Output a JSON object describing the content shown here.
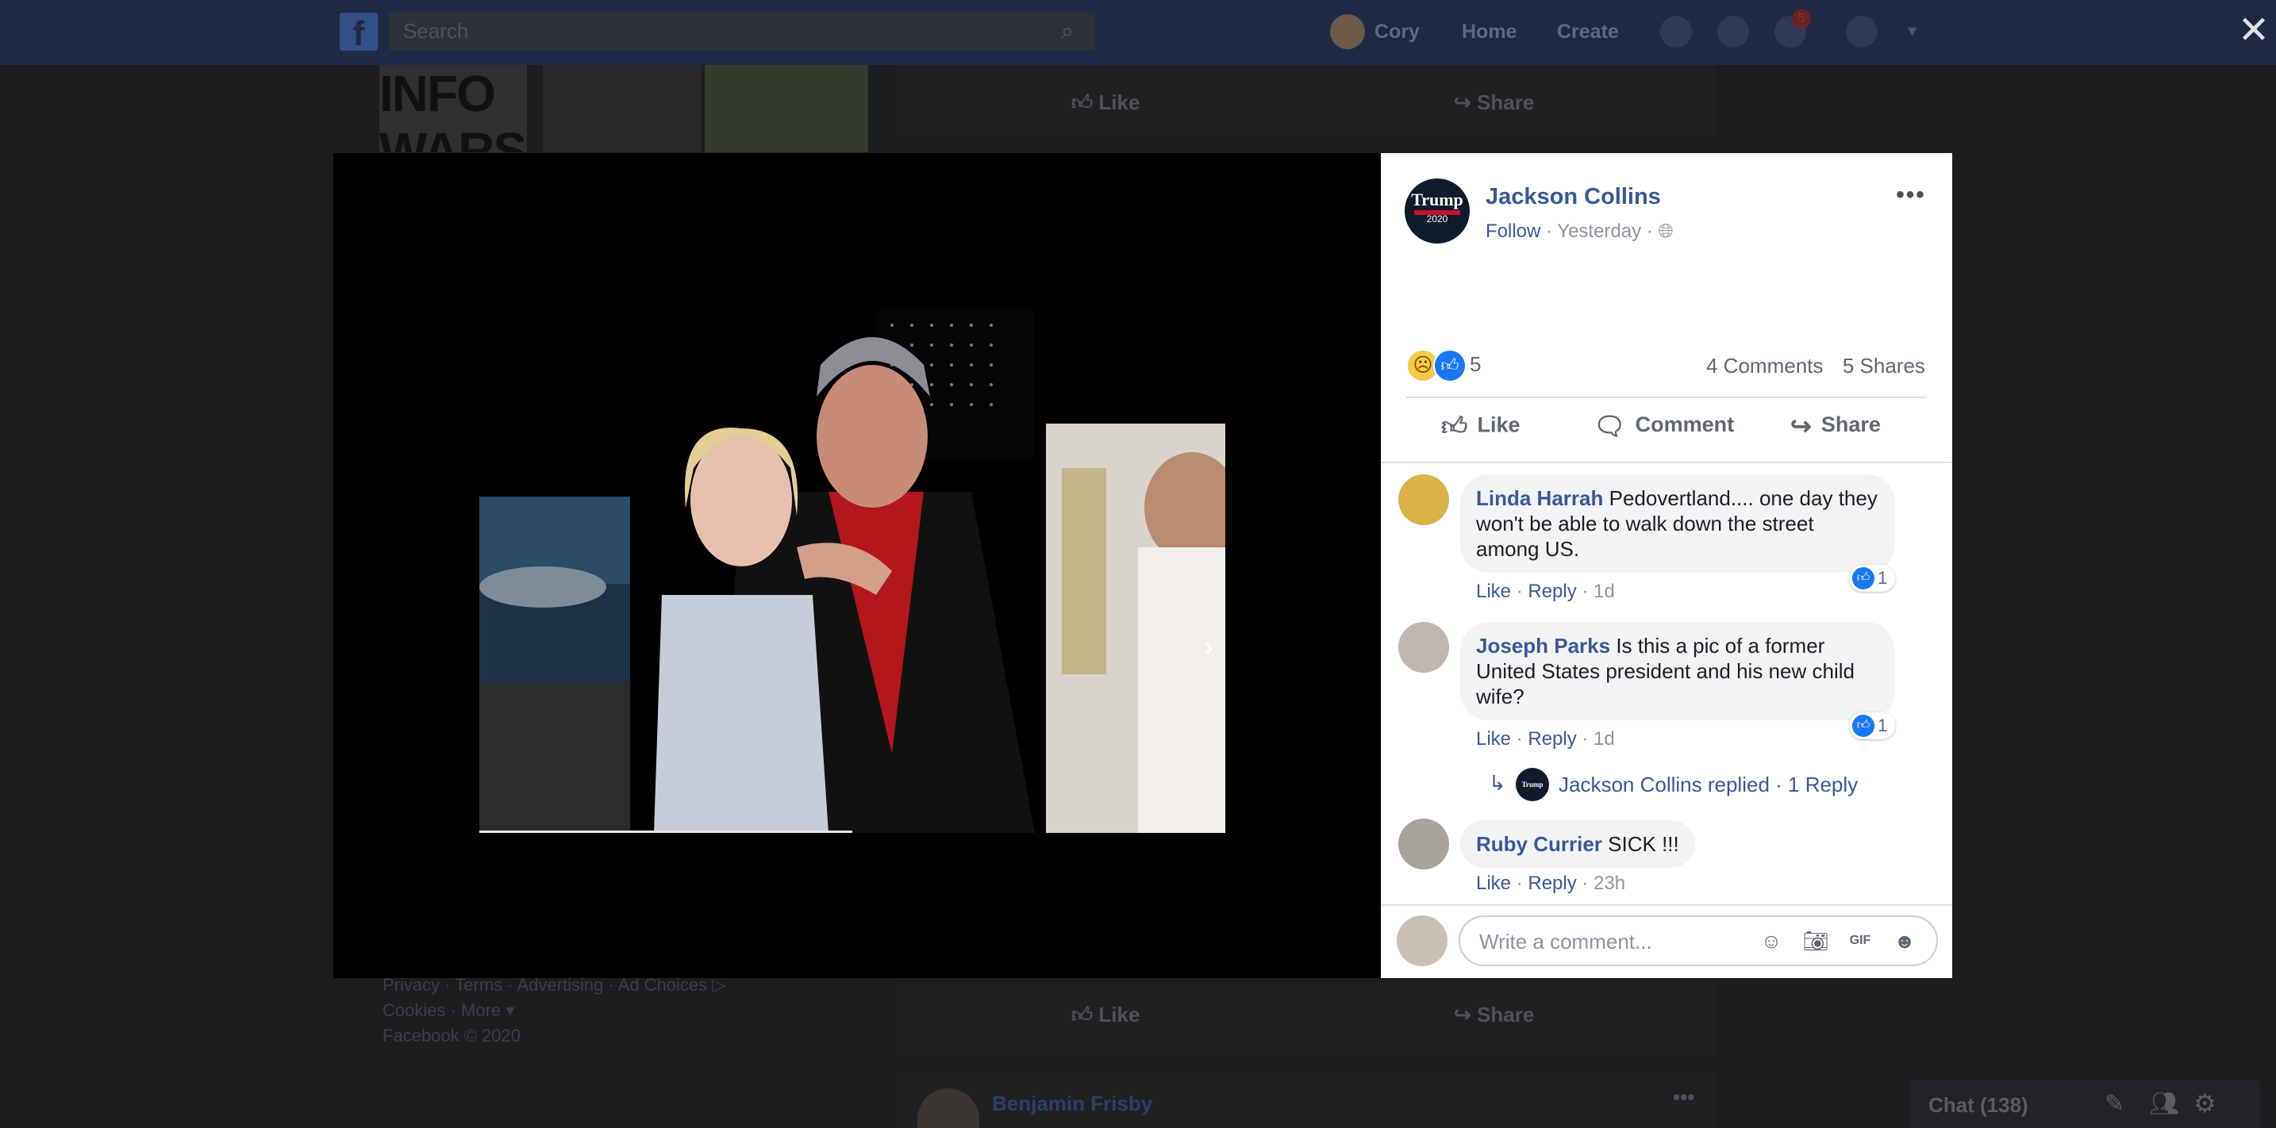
{
  "topbar": {
    "search_placeholder": "Search",
    "user_name": "Cory",
    "home_label": "Home",
    "create_label": "Create",
    "notification_count": "5"
  },
  "background": {
    "brand_text": "INFO WARS",
    "like_label": "Like",
    "share_label": "Share",
    "footer_line1": "Privacy · Terms · Advertising · Ad Choices ▷",
    "footer_line2": "Cookies · More ▾",
    "footer_copyright": "Facebook © 2020",
    "next_post_author": "Benjamin Frisby",
    "chat_label": "Chat (138)"
  },
  "post": {
    "author": "Jackson Collins",
    "follow_label": "Follow",
    "time": "Yesterday",
    "avatar_text": "Trump",
    "avatar_sub": "2020",
    "reaction_count": "5",
    "comments_count": "4 Comments",
    "shares_count": "5 Shares",
    "actions": {
      "like": "Like",
      "comment": "Comment",
      "share": "Share"
    }
  },
  "comments": [
    {
      "name": "Linda Harrah",
      "text": "Pedovertland.... one day they won't be able to walk down the street among US.",
      "like": "Like",
      "reply": "Reply",
      "time": "1d",
      "likes": "1"
    },
    {
      "name": "Joseph Parks",
      "text": "Is this a pic of a former United States president and his new child wife?",
      "like": "Like",
      "reply": "Reply",
      "time": "1d",
      "likes": "1"
    },
    {
      "name": "Ruby Currier",
      "text": "SICK !!!",
      "like": "Like",
      "reply": "Reply",
      "time": "23h"
    }
  ],
  "reply_thread": {
    "text": "Jackson Collins replied",
    "count": "1 Reply"
  },
  "write": {
    "placeholder": "Write a comment..."
  },
  "icons": {
    "close": "close-icon",
    "next": "chevron-right-icon",
    "emoji": "emoji-icon",
    "camera": "camera-icon",
    "gif": "gif-icon",
    "sticker": "sticker-icon"
  },
  "colors": {
    "link_blue": "#385898",
    "fb_blue": "#1877f2",
    "bubble": "#f2f3f5"
  }
}
